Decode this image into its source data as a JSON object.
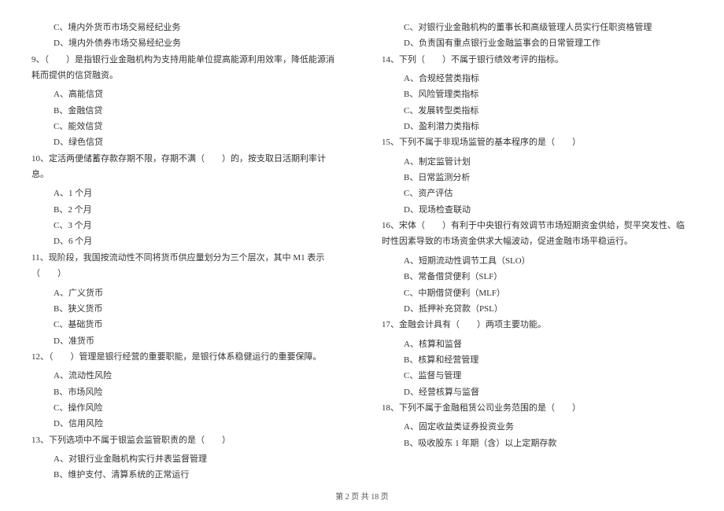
{
  "left_column": {
    "q8_optC": "C、境内外货币市场交易经纪业务",
    "q8_optD": "D、境内外债券市场交易经纪业务",
    "q9_text": "9、（　　）是指银行业金融机构为支持用能单位提高能源利用效率，降低能源消耗而提供的信贷融资。",
    "q9_optA": "A、高能信贷",
    "q9_optB": "B、金融信贷",
    "q9_optC": "C、能效信贷",
    "q9_optD": "D、绿色信贷",
    "q10_text": "10、定活两便储蓄存款存期不限，存期不满（　　）的，按支取日活期利率计息。",
    "q10_optA": "A、1 个月",
    "q10_optB": "B、2 个月",
    "q10_optC": "C、3 个月",
    "q10_optD": "D、6 个月",
    "q11_text": "11、现阶段，我国按流动性不同将货币供应量划分为三个层次，其中 M1 表示（　　）",
    "q11_optA": "A、广义货币",
    "q11_optB": "B、狭义货币",
    "q11_optC": "C、基础货币",
    "q11_optD": "D、准货币",
    "q12_text": "12、（　　）管理是银行经营的重要职能，是银行体系稳健运行的重要保障。",
    "q12_optA": "A、流动性风险",
    "q12_optB": "B、市场风险",
    "q12_optC": "C、操作风险",
    "q12_optD": "D、信用风险",
    "q13_text": "13、下列选项中不属于银监会监管职责的是（　　）",
    "q13_optA": "A、对银行业金融机构实行并表监督管理",
    "q13_optB": "B、维护支付、清算系统的正常运行"
  },
  "right_column": {
    "q13_optC": "C、对银行业金融机构的董事长和高级管理人员实行任职资格管理",
    "q13_optD": "D、负责国有重点银行业金融监事会的日常管理工作",
    "q14_text": "14、下列（　　）不属于银行绩效考评的指标。",
    "q14_optA": "A、合规经营类指标",
    "q14_optB": "B、风险管理类指标",
    "q14_optC": "C、发展转型类指标",
    "q14_optD": "D、盈利潜力类指标",
    "q15_text": "15、下列不属于非现场监管的基本程序的是（　　）",
    "q15_optA": "A、制定监管计划",
    "q15_optB": "B、日常监测分析",
    "q15_optC": "C、资产评估",
    "q15_optD": "D、现场检查联动",
    "q16_text": "16、宋体（　　）有利于中央银行有效调节市场短期资金供给，熨平突发性、临时性因素导致的市场资金供求大幅波动，促进金融市场平稳运行。",
    "q16_optA": "A、短期流动性调节工具（SLO）",
    "q16_optB": "B、常备借贷便利（SLF）",
    "q16_optC": "C、中期借贷便利（MLF）",
    "q16_optD": "D、抵押补充贷款（PSL）",
    "q17_text": "17、金融会计具有（　　）两项主要功能。",
    "q17_optA": "A、核算和监督",
    "q17_optB": "B、核算和经营管理",
    "q17_optC": "C、监督与管理",
    "q17_optD": "D、经营核算与监督",
    "q18_text": "18、下列不属于金融租赁公司业务范围的是（　　）",
    "q18_optA": "A、固定收益类证券投资业务",
    "q18_optB": "B、吸收股东 1 年期（含）以上定期存款"
  },
  "footer": "第 2 页 共 18 页"
}
